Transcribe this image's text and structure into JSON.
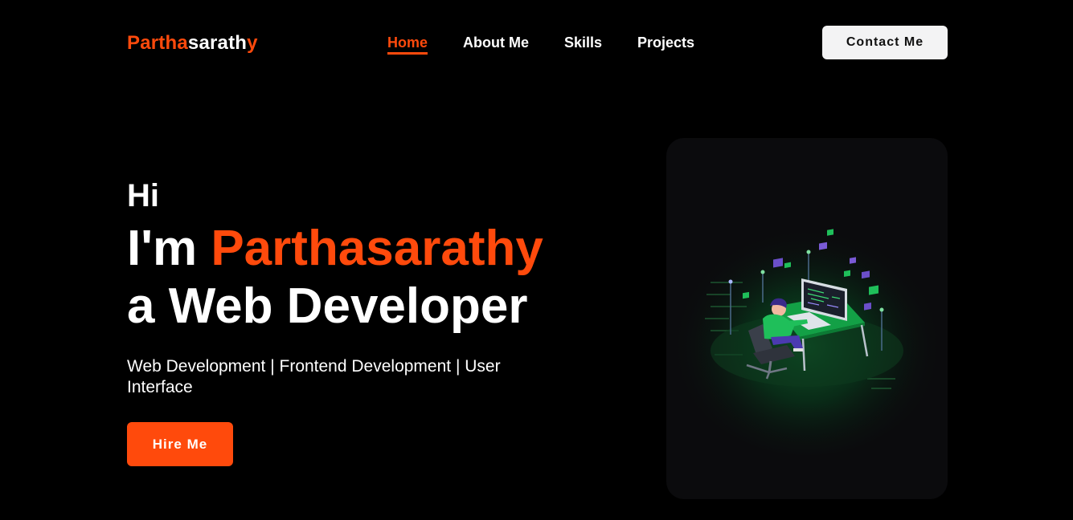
{
  "header": {
    "logo": {
      "part1": "Partha",
      "part2": "sarath",
      "part3": "y"
    },
    "nav": [
      {
        "label": "Home",
        "active": true
      },
      {
        "label": "About Me",
        "active": false
      },
      {
        "label": "Skills",
        "active": false
      },
      {
        "label": "Projects",
        "active": false
      }
    ],
    "contact_label": "Contact Me"
  },
  "hero": {
    "greeting": "Hi",
    "intro_prefix": "I'm ",
    "name": "Parthasarathy",
    "role": "a Web Developer",
    "tagline": "Web Development | Frontend Development | User Interface",
    "hire_label": "Hire Me"
  },
  "colors": {
    "accent": "#ff4a0c",
    "background": "#000000",
    "card": "#0b0b0d",
    "illustration_green": "#1fbf5a",
    "illustration_purple": "#6b4fc9"
  },
  "illustration": {
    "icon": "developer-at-desk-illustration"
  }
}
